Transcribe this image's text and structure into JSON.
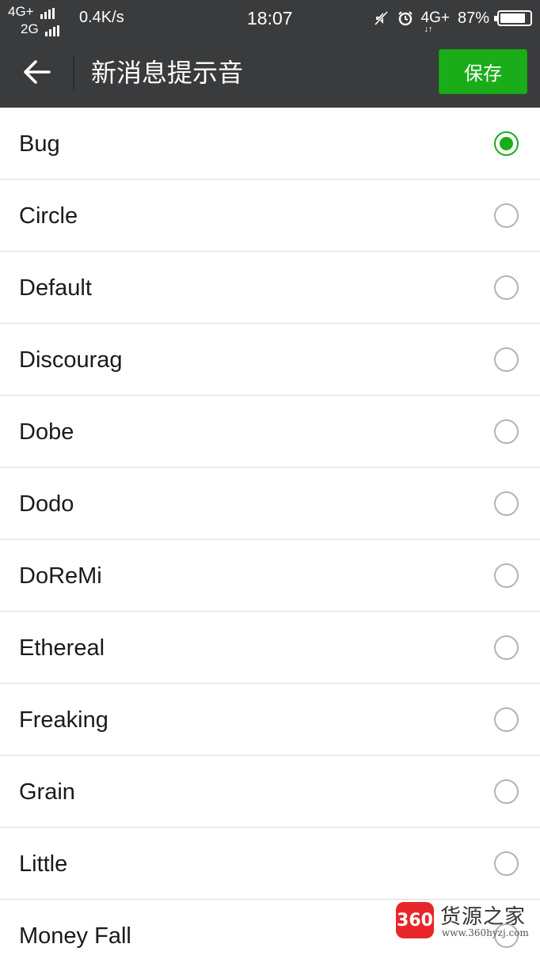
{
  "status_bar": {
    "net_line1": "4G+",
    "net_line2": "2G",
    "speed": "0.4K/s",
    "time": "18:07",
    "net_right": "4G+",
    "battery_text": "87%",
    "battery_level": 0.87
  },
  "header": {
    "title": "新消息提示音",
    "save_label": "保存"
  },
  "sounds": [
    {
      "label": "Bug",
      "selected": true
    },
    {
      "label": "Circle",
      "selected": false
    },
    {
      "label": "Default",
      "selected": false
    },
    {
      "label": "Discourag",
      "selected": false
    },
    {
      "label": "Dobe",
      "selected": false
    },
    {
      "label": "Dodo",
      "selected": false
    },
    {
      "label": "DoReMi",
      "selected": false
    },
    {
      "label": "Ethereal",
      "selected": false
    },
    {
      "label": "Freaking",
      "selected": false
    },
    {
      "label": "Grain",
      "selected": false
    },
    {
      "label": "Little",
      "selected": false
    },
    {
      "label": "Money Fall",
      "selected": false
    }
  ],
  "watermark": {
    "badge": "360",
    "name": "货源之家",
    "url": "www.360hyzj.com"
  },
  "colors": {
    "accent": "#1aad19",
    "appbar": "#3a3b3d",
    "divider": "#d9d9d9",
    "radio_unchecked": "#b3b3b3"
  }
}
